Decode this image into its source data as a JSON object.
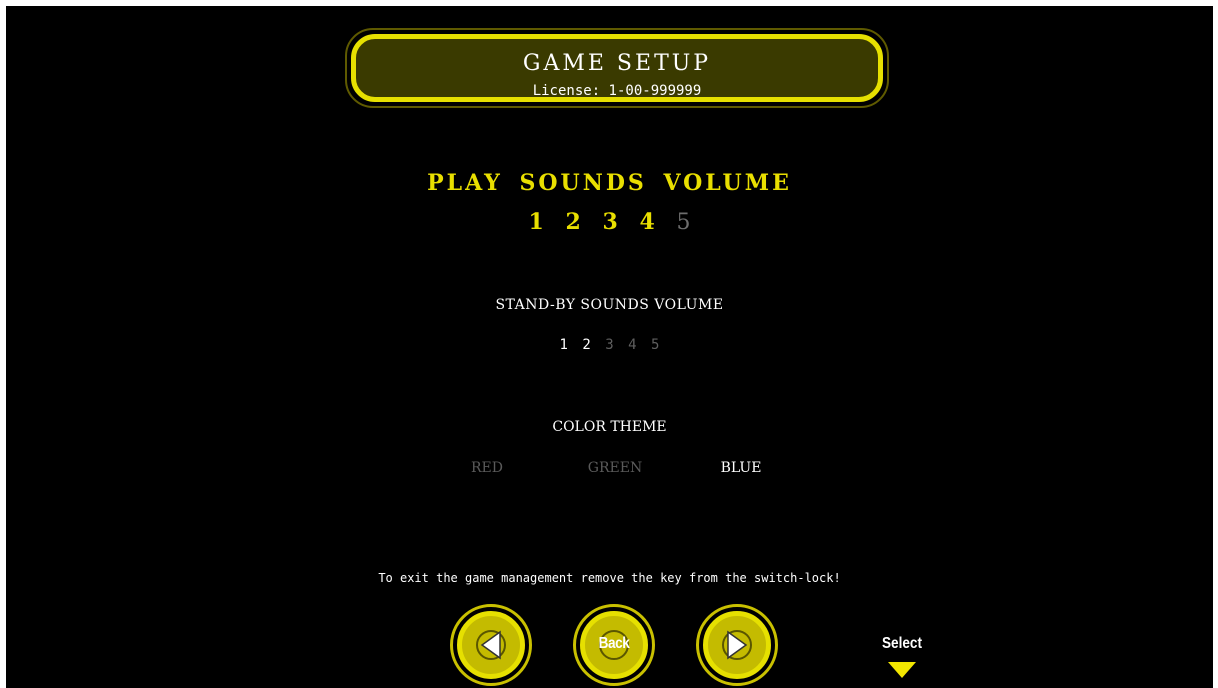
{
  "header": {
    "title": "GAME SETUP",
    "license": "License: 1-00-999999"
  },
  "play_sounds": {
    "title": "PLAY SOUNDS VOLUME",
    "levels": [
      "1",
      "2",
      "3",
      "4",
      "5"
    ],
    "selected_level": 4
  },
  "standby_sounds": {
    "title": "STAND-BY SOUNDS VOLUME",
    "levels": [
      "1",
      "2",
      "3",
      "4",
      "5"
    ],
    "selected_level": 2
  },
  "color_theme": {
    "title": "COLOR THEME",
    "options": [
      "RED",
      "GREEN",
      "BLUE"
    ],
    "selected": "BLUE"
  },
  "exit_hint": "To exit the game management remove the key from the switch-lock!",
  "buttons": {
    "back_label": "Back",
    "select_label": "Select"
  },
  "icons": {
    "prev": "triangle-left-icon",
    "next": "triangle-right-icon",
    "select": "triangle-down-icon"
  },
  "colors": {
    "accent_yellow": "#e9df00",
    "panel_dark_yellow": "#3a3a00",
    "dim_gray": "#5f5f5f",
    "background": "#000000"
  }
}
